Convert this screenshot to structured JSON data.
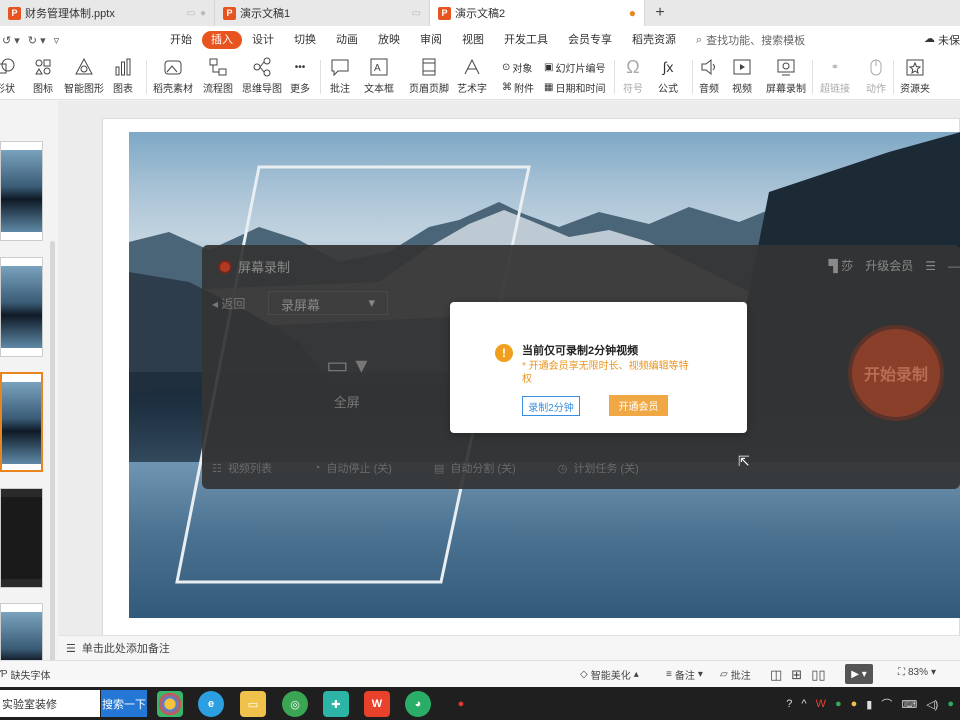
{
  "tabs": [
    {
      "title": "财务管理体制.pptx",
      "active": false
    },
    {
      "title": "演示文稿1",
      "active": false
    },
    {
      "title": "演示文稿2",
      "active": true
    }
  ],
  "tab_add": "+",
  "menus": [
    "开始",
    "插入",
    "设计",
    "切换",
    "动画",
    "放映",
    "审阅",
    "视图",
    "开发工具",
    "会员专享",
    "稻壳资源"
  ],
  "active_menu": "插入",
  "search_placeholder": "查找功能、搜索模板",
  "cloud_label": "未保",
  "toolbar": {
    "shape": "形状",
    "icon": "图标",
    "smartart": "智能图形",
    "chart": "图表",
    "material": "稻壳素材",
    "flowchart": "流程图",
    "mindmap": "思维导图",
    "more": "更多",
    "comment": "批注",
    "textbox": "文本框",
    "header_footer": "页眉页脚",
    "wordart": "艺术字",
    "object": "对象",
    "attachment": "附件",
    "slide_number": "幻灯片编号",
    "datetime": "日期和时间",
    "symbol": "符号",
    "formula": "公式",
    "audio": "音频",
    "video": "视频",
    "screen_record": "屏幕录制",
    "hyperlink": "超链接",
    "action": "动作",
    "resource": "资源夹"
  },
  "recorder": {
    "title": "屏幕录制",
    "upgrade": "升级会员",
    "back": "返回",
    "mode": "录屏幕",
    "screen_label": "全屏",
    "start": "开始录制",
    "bottom": [
      "视频列表",
      "自动停止 (关)",
      "自动分割 (关)",
      "计划任务 (关)"
    ]
  },
  "dialog": {
    "title": "当前仅可录制2分钟视频",
    "subtitle": "* 开通会员享无限时长、视频编辑等特权",
    "btn_trial": "录制2分钟",
    "btn_vip": "开通会员",
    "accent": "#e8951f"
  },
  "notes_placeholder": "单击此处添加备注",
  "status": {
    "missing_font": "缺失字体",
    "beautify": "智能美化",
    "notes": "备注",
    "comments": "批注",
    "zoom": "83%"
  },
  "taskbar": {
    "search_text": "实验室装修",
    "search_button": "搜索一下"
  },
  "colors": {
    "accent": "#e8541f",
    "record": "#8a3f2a"
  }
}
